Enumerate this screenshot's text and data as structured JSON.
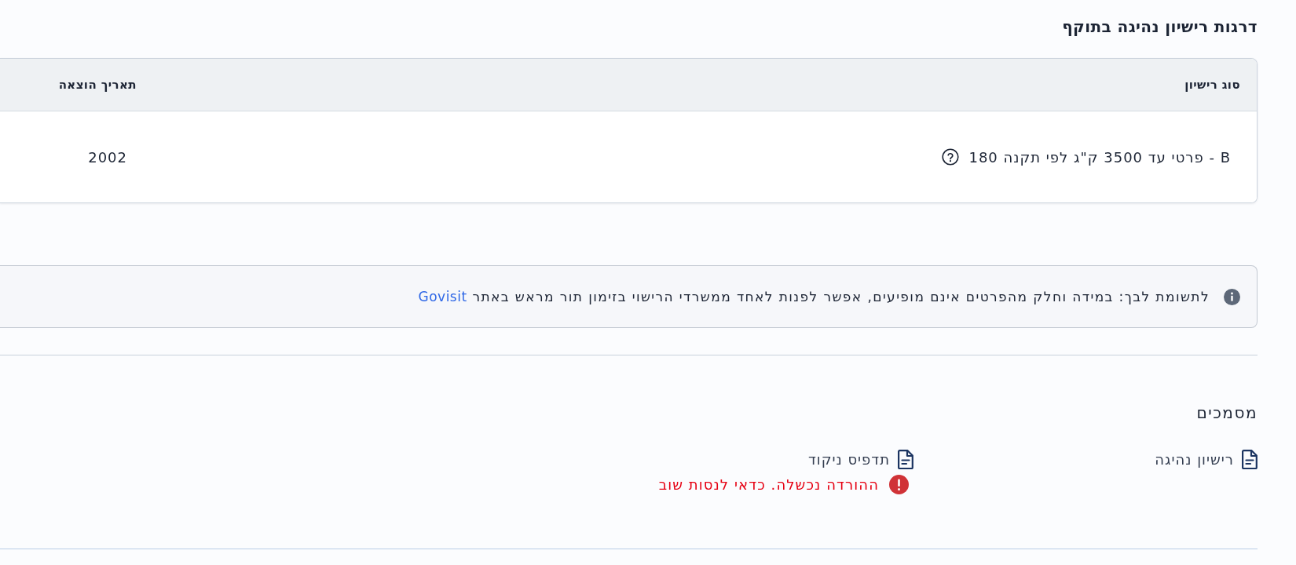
{
  "licence_grades": {
    "title": "דרגות רישיון נהיגה בתוקף",
    "table": {
      "columns": [
        "סוג רישיון",
        "תאריך הוצאה"
      ],
      "rows": [
        {
          "cells": [
            "B - פרטי עד 3500 ק\"ג לפי תקנה 180",
            "2002"
          ]
        }
      ]
    }
  },
  "notice": {
    "text": "לתשומת לבך: במידה וחלק מהפרטים אינם מופיעים, אפשר לפנות לאחד ממשרדי הרישוי בזימון תור מראש באתר",
    "link": "Govisit"
  },
  "documents": {
    "title": "מסמכים",
    "items": [
      {
        "label": "רישיון נהיגה"
      },
      {
        "label": "תדפיס ניקוד",
        "error": "ההורדה נכשלה. כדאי לנסות שוב"
      }
    ]
  }
}
